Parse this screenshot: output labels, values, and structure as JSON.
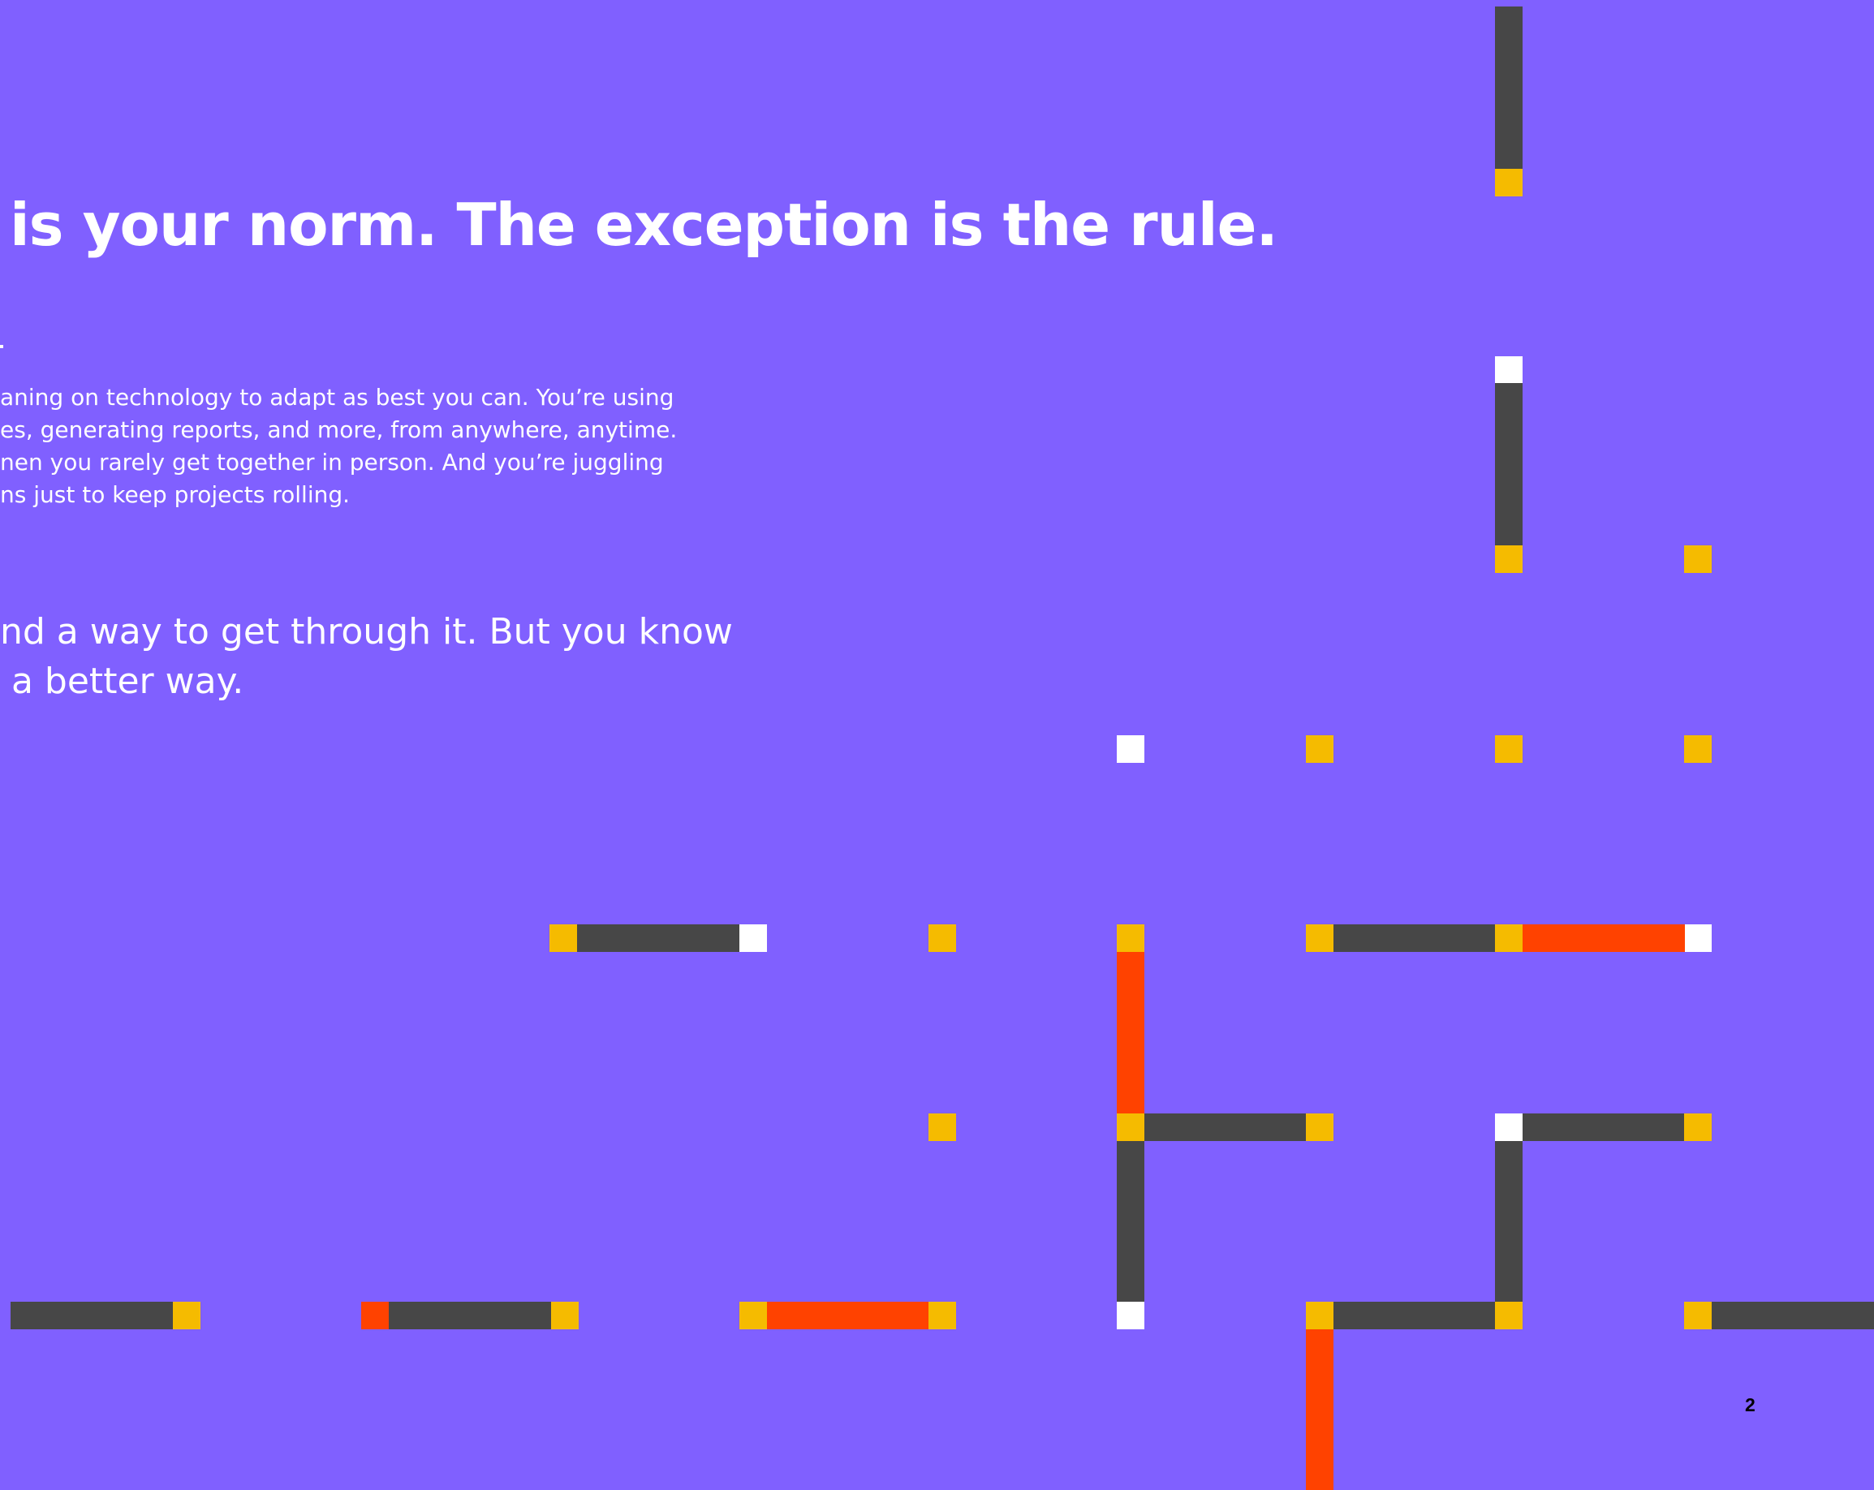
{
  "page": {
    "headline": "is your norm. The exception is the rule.",
    "body_lines": [
      "aning on technology to adapt as best you can. You’re using",
      "es, generating reports, and more, from anywhere, anytime.",
      "nen you rarely get together in person. And you’re juggling",
      "ns just to keep projects rolling."
    ],
    "lead_lines": [
      "nd a way to get through it. But you know",
      " a better way."
    ],
    "page_number": "2"
  },
  "colors": {
    "background": "#8060ff",
    "line_dark": "#474747",
    "line_orange": "#ff4200",
    "node_yellow": "#f5bb00",
    "node_white": "#ffffff",
    "text": "#ffffff",
    "page_number": "#000000"
  }
}
